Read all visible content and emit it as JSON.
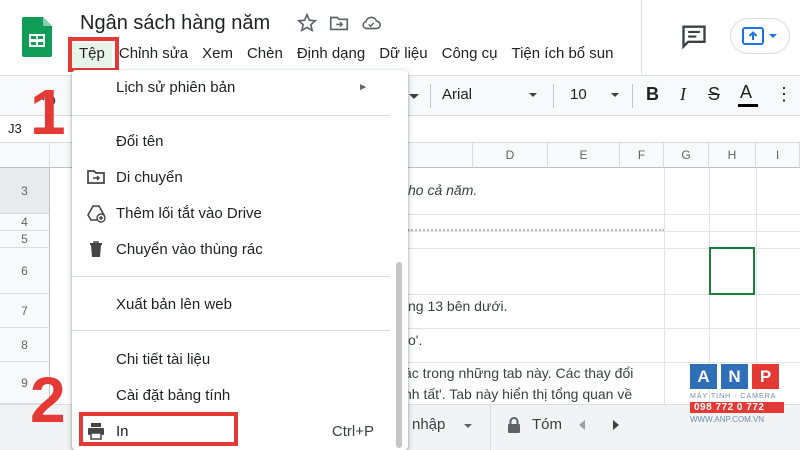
{
  "doc": {
    "title": "Ngân sách hàng năm"
  },
  "menubar": {
    "items": [
      "Tệp",
      "Chỉnh sửa",
      "Xem",
      "Chèn",
      "Định dạng",
      "Dữ liệu",
      "Công cụ",
      "Tiện ích bổ sun"
    ]
  },
  "toolbar": {
    "font": "Arial",
    "size": "10",
    "bold": "B",
    "italic": "I",
    "strike": "S",
    "text_color": "A",
    "more": "⋮"
  },
  "formula": {
    "cell_ref": "J3"
  },
  "grid": {
    "columns": [
      "D",
      "E",
      "F",
      "G",
      "H",
      "I"
    ],
    "rows": [
      "3",
      "4",
      "5",
      "6",
      "7",
      "8",
      "9"
    ],
    "cells": {
      "r3": "ho cả năm.",
      "r7": "ng 13 bên dưới.",
      "r8": "o'.",
      "r9a": "ác trong những tab này. Các thay đổi",
      "r9b": "nh tất'. Tab này hiển thị tổng quan về"
    }
  },
  "file_menu": {
    "items": [
      {
        "label": "Lịch sử phiên bản",
        "submenu": "►"
      },
      {
        "label": "Đổi tên"
      },
      {
        "label": "Di chuyển"
      },
      {
        "label": "Thêm lối tắt vào Drive"
      },
      {
        "label": "Chuyển vào thùng rác"
      },
      {
        "label": "Xuất bản lên web"
      },
      {
        "label": "Chi tiết tài liệu"
      },
      {
        "label": "Cài đặt bảng tính"
      },
      {
        "label": "In",
        "shortcut": "Ctrl+P"
      }
    ]
  },
  "sheet_tabs": {
    "tab1": "nhập",
    "tab2": "Tóm"
  },
  "steps": {
    "one": "1",
    "two": "2"
  },
  "watermark": {
    "letters": [
      "A",
      "N",
      "P"
    ],
    "tagline": "MÁY TÍNH · CAMERA",
    "phone": "098 772 0 772",
    "website": "WWW.ANP.COM.VN"
  },
  "colors": {
    "highlight": "#e53935",
    "sheets_green": "#0f9d58",
    "selection": "#188038"
  }
}
